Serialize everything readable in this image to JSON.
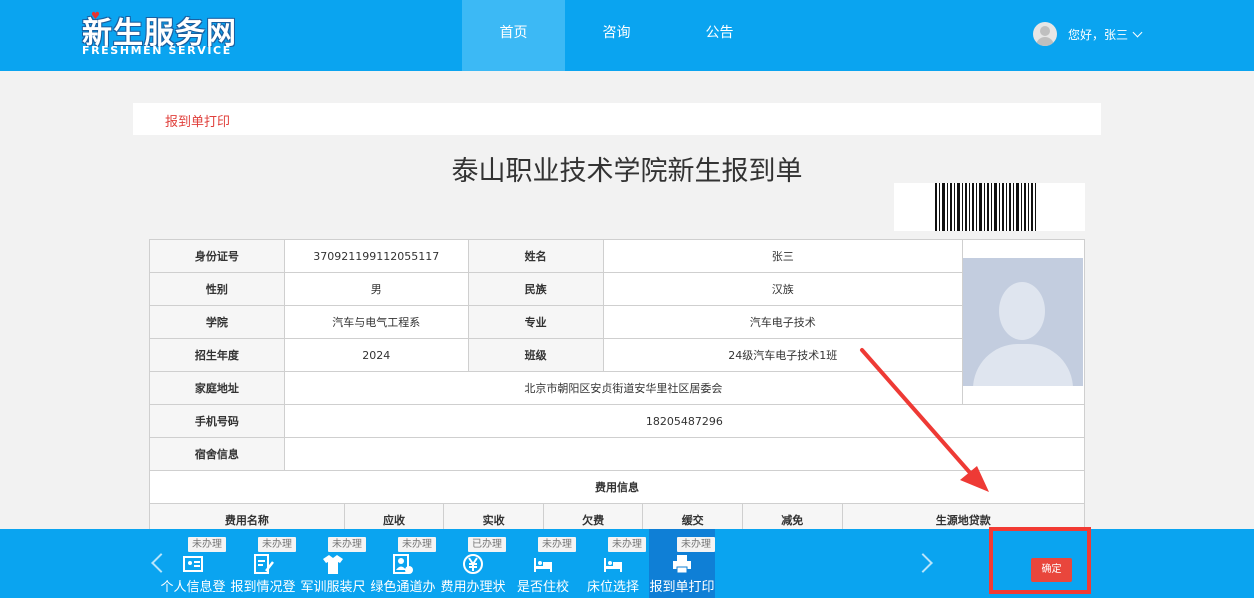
{
  "header": {
    "logo_cn": "新生服务网",
    "logo_en": "FRESHMEN SERVICE",
    "nav": [
      {
        "label": "首页",
        "active": true
      },
      {
        "label": "咨询",
        "active": false
      },
      {
        "label": "公告",
        "active": false
      }
    ],
    "user_greeting": "您好，张三"
  },
  "breadcrumb": "报到单打印",
  "document": {
    "title": "泰山职业技术学院新生报到单",
    "rows": {
      "id_label": "身份证号",
      "id_value": "370921199112055117",
      "name_label": "姓名",
      "name_value": "张三",
      "gender_label": "性别",
      "gender_value": "男",
      "ethnicity_label": "民族",
      "ethnicity_value": "汉族",
      "college_label": "学院",
      "college_value": "汽车与电气工程系",
      "major_label": "专业",
      "major_value": "汽车电子技术",
      "year_label": "招生年度",
      "year_value": "2024",
      "class_label": "班级",
      "class_value": "24级汽车电子技术1班",
      "address_label": "家庭地址",
      "address_value": "北京市朝阳区安贞街道安华里社区居委会",
      "phone_label": "手机号码",
      "phone_value": "18205487296",
      "dorm_label": "宿舍信息",
      "dorm_value": ""
    },
    "fee_section_title": "费用信息",
    "fee_headers": [
      "费用名称",
      "应收",
      "实收",
      "欠费",
      "缓交",
      "减免",
      "生源地贷款"
    ]
  },
  "steps": [
    {
      "label": "个人信息登",
      "status": "未办理",
      "icon": "id-card-icon"
    },
    {
      "label": "报到情况登",
      "status": "未办理",
      "icon": "edit-form-icon"
    },
    {
      "label": "军训服装尺",
      "status": "未办理",
      "icon": "tshirt-icon"
    },
    {
      "label": "绿色通道办",
      "status": "未办理",
      "icon": "person-card-icon"
    },
    {
      "label": "费用办理状",
      "status": "已办理",
      "icon": "yuan-coin-icon"
    },
    {
      "label": "是否住校",
      "status": "未办理",
      "icon": "bed-icon"
    },
    {
      "label": "床位选择",
      "status": "未办理",
      "icon": "bed-icon"
    },
    {
      "label": "报到单打印",
      "status": "未办理",
      "icon": "printer-icon",
      "active": true
    }
  ],
  "confirm_label": "确定",
  "colors": {
    "header_blue": "#0aa4f0",
    "accent_red": "#e9463c"
  }
}
